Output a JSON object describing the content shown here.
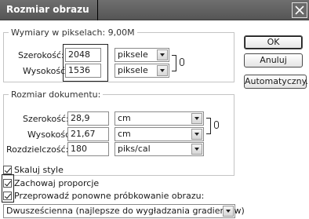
{
  "window": {
    "title": "Rozmiar obrazu"
  },
  "pixel_dims": {
    "legend": "Wymiary w pikselach: 9,00M",
    "width_label": "Szerokość:",
    "width_value": "2048",
    "width_unit": "piksele",
    "height_label": "Wysokość:",
    "height_value": "1536",
    "height_unit": "piksele"
  },
  "doc_size": {
    "legend": "Rozmiar dokumentu:",
    "width_label": "Szerokość:",
    "width_value": "28,9",
    "width_unit": "cm",
    "height_label": "Wysokość:",
    "height_value": "21,67",
    "height_unit": "cm",
    "resolution_label": "Rozdzielczość:",
    "resolution_value": "180",
    "resolution_unit": "piks/cal"
  },
  "buttons": {
    "ok": "OK",
    "cancel": "Anuluj",
    "auto": "Automatyczny..."
  },
  "options": {
    "scale_styles": "Skaluj style",
    "constrain": "Zachowaj proporcje",
    "resample": "Przeprowadź ponowne próbkowanie obrazu:",
    "resample_method": "Dwusześcienna (najlepsze do wygładzania gradientów)"
  }
}
